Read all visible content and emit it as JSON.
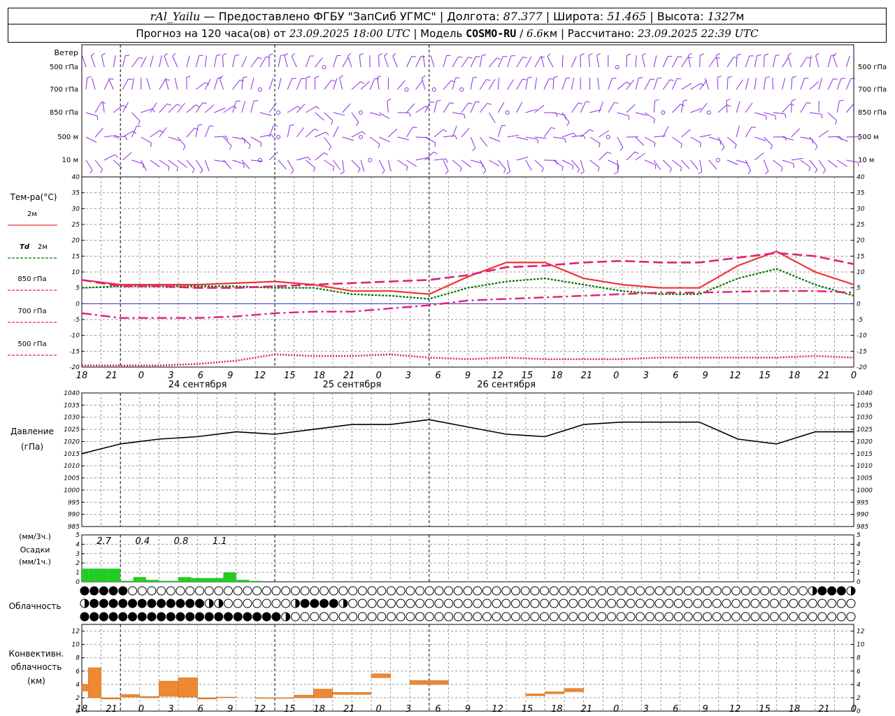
{
  "header": {
    "station": "rAl_Yailu",
    "dash": " — ",
    "provider": "Предоставлено ФГБУ \"ЗапСиб УГМС\"",
    "lon_label": "Долгота:",
    "lon_value": "87.377",
    "lat_label": "Широта:",
    "lat_value": "51.465",
    "alt_label": "Высота:",
    "alt_value": "1327",
    "alt_unit": "м",
    "sep": " | "
  },
  "subheader": {
    "forecast_label": "Прогноз на 120 часа(ов) от",
    "forecast_start": "23.09.2025 18:00 UTC",
    "model_label": "Модель",
    "model_name": "COSMO-RU",
    "model_res": "6.6",
    "model_res_unit": "км",
    "computed_label": "Рассчитано:",
    "computed_value": "23.09.2025 22:39 UTC",
    "sep": " | "
  },
  "colors": {
    "wind": "#8a2be2",
    "t2m": "#ee3333",
    "td2m": "#007700",
    "t850": "#e0207a",
    "t700": "#e0207a",
    "t500": "#e0207a",
    "pressure": "#000000",
    "precip": "#22cc22",
    "convective": "#ee8833",
    "grid": "#999999",
    "zero_line": "#3333cc"
  },
  "time_axis": {
    "hour_labels": [
      "18",
      "21",
      "0",
      "3",
      "6",
      "9",
      "12",
      "15",
      "18",
      "21",
      "0",
      "3",
      "6",
      "9",
      "12",
      "15",
      "18",
      "21",
      "0",
      "3",
      "6",
      "9",
      "12",
      "15",
      "18",
      "21",
      "0"
    ],
    "date_labels": [
      "24 сентября",
      "25 сентября",
      "26 сентября"
    ],
    "day_start_index": [
      2,
      10,
      18
    ]
  },
  "wind_panel": {
    "title": "Ветер",
    "levels": [
      "500 гПа",
      "700 гПа",
      "850 гПа",
      "500 м",
      "10 м"
    ]
  },
  "temp_panel": {
    "title": "Тем-ра(°С)",
    "legend": [
      {
        "label": "2м",
        "style": "solid",
        "series": "t2m"
      },
      {
        "label_main": "Td",
        "label": "2м",
        "style": "dotted",
        "series": "td2m"
      },
      {
        "label": "850 гПа",
        "style": "dash",
        "series": "t850"
      },
      {
        "label": "700 гПа",
        "style": "dashdot",
        "series": "t700"
      },
      {
        "label": "500 гПа",
        "style": "dot",
        "series": "t500"
      }
    ],
    "ticks": [
      "40",
      "35",
      "30",
      "25",
      "20",
      "15",
      "10",
      "5",
      "0",
      "-5",
      "-10",
      "-15",
      "-20"
    ]
  },
  "pressure_panel": {
    "title": "Давление",
    "unit": "(гПа)",
    "ticks": [
      "1040",
      "1035",
      "1030",
      "1025",
      "1020",
      "1015",
      "1010",
      "1005",
      "1000",
      "995",
      "990",
      "985"
    ]
  },
  "precip_panel": {
    "unit_top": "(мм/3ч.)",
    "title": "Осадки",
    "unit_bottom": "(мм/1ч.)",
    "ticks": [
      "5",
      "4",
      "3",
      "2",
      "1",
      "0"
    ],
    "totals": [
      "2.7",
      "0.4",
      "0.8",
      "1.1"
    ]
  },
  "cloud_panel": {
    "title": "Облачность"
  },
  "conv_panel": {
    "title_line1": "Конвективн.",
    "title_line2": "облачность",
    "unit": "(км)",
    "ticks": [
      "12",
      "10",
      "8",
      "6",
      "4",
      "2",
      "0"
    ]
  },
  "chart_data": [
    {
      "type": "line",
      "name": "temperature",
      "ylabel": "Тем-ра(°С)",
      "ylim": [
        -20,
        40
      ],
      "x_hours": [
        0,
        6,
        12,
        18,
        24,
        30,
        36,
        42,
        48,
        54,
        60,
        66,
        72,
        78,
        84,
        90,
        96,
        102,
        108,
        114,
        120
      ],
      "series": [
        {
          "name": "2м",
          "values": [
            7.5,
            6,
            6,
            6,
            6.5,
            7,
            6,
            4,
            4,
            3,
            8.5,
            13,
            13,
            8,
            6,
            5,
            5,
            12,
            16.5,
            10,
            6
          ]
        },
        {
          "name": "Td 2м",
          "values": [
            5,
            5.5,
            5.5,
            5.5,
            5.5,
            5,
            5,
            3,
            2.5,
            1.5,
            5,
            7,
            8,
            6,
            4,
            3,
            3,
            8,
            11,
            6,
            2.5
          ]
        },
        {
          "name": "850 гПа",
          "values": [
            7.5,
            5.5,
            5.5,
            5,
            5,
            5.5,
            6,
            6.5,
            7,
            7.5,
            9,
            11.5,
            12,
            13,
            13.5,
            13,
            13,
            14.5,
            16,
            15,
            12.5
          ]
        },
        {
          "name": "700 гПа",
          "values": [
            -3,
            -4.5,
            -4.5,
            -4.5,
            -4,
            -3,
            -2.5,
            -2.5,
            -1.5,
            -0.5,
            1,
            1.5,
            2,
            2.5,
            3,
            3.5,
            3.5,
            3.8,
            4,
            4,
            3.5
          ]
        },
        {
          "name": "500 гПа",
          "values": [
            -19.5,
            -19.5,
            -19.5,
            -19,
            -18,
            -16,
            -16.5,
            -16.5,
            -16,
            -17,
            -17.5,
            -17,
            -17.5,
            -17.5,
            -17.5,
            -17,
            -17,
            -17,
            -17,
            -16.5,
            -17
          ]
        }
      ]
    },
    {
      "type": "line",
      "name": "pressure",
      "ylabel": "Давление (гПа)",
      "ylim": [
        985,
        1040
      ],
      "x_hours": [
        0,
        6,
        12,
        18,
        24,
        30,
        36,
        42,
        48,
        54,
        60,
        66,
        72,
        78,
        84,
        90,
        96,
        102,
        108,
        114,
        120
      ],
      "series": [
        {
          "name": "Давление",
          "values": [
            1015,
            1019,
            1021,
            1022,
            1024,
            1023,
            1025,
            1027,
            1027,
            1029,
            1026,
            1023,
            1022,
            1027,
            1028,
            1028,
            1028,
            1021,
            1019,
            1024,
            1024
          ]
        }
      ]
    },
    {
      "type": "bar",
      "name": "precipitation",
      "ylabel": "Осадки (мм/1ч.)",
      "ylim": [
        0,
        5
      ],
      "x_hours": [
        0,
        1,
        2,
        3,
        4,
        5,
        6,
        7,
        8,
        9,
        10,
        11,
        12,
        13,
        14,
        15,
        16,
        17,
        18,
        19,
        20,
        21,
        22,
        23,
        24,
        25,
        26,
        27
      ],
      "values": [
        1.4,
        1.4,
        1.4,
        1.4,
        1.4,
        1.4,
        0.1,
        0.1,
        0.5,
        0.5,
        0.2,
        0.2,
        0.1,
        0.1,
        0.1,
        0.5,
        0.5,
        0.4,
        0.4,
        0.4,
        0.4,
        0.4,
        1.0,
        1.0,
        0.2,
        0.2,
        0.1,
        0.1
      ]
    },
    {
      "type": "bar",
      "name": "convective_cloud",
      "ylabel": "Конвективн. облачность (км)",
      "ylim": [
        0,
        13
      ],
      "bars": [
        [
          0,
          1,
          3,
          4
        ],
        [
          1,
          3,
          2,
          6.5
        ],
        [
          3,
          6,
          1.8,
          2
        ],
        [
          6,
          9,
          2.1,
          2.5
        ],
        [
          9,
          12,
          2,
          2.2
        ],
        [
          12,
          15,
          2.2,
          4.5
        ],
        [
          15,
          18,
          2.1,
          5
        ],
        [
          18,
          21,
          1.8,
          2
        ],
        [
          21,
          24,
          2,
          2.1
        ],
        [
          24,
          27,
          2,
          2
        ],
        [
          27,
          33,
          1.9,
          2
        ],
        [
          33,
          36,
          2,
          2.4
        ],
        [
          36,
          39,
          2,
          3.3
        ],
        [
          39,
          45,
          2.5,
          2.8
        ],
        [
          45,
          48,
          5,
          5.6
        ],
        [
          51,
          57,
          4,
          4.6
        ],
        [
          69,
          72,
          2.3,
          2.6
        ],
        [
          72,
          75,
          2.6,
          2.9
        ],
        [
          75,
          78,
          2.9,
          3.4
        ]
      ]
    }
  ]
}
